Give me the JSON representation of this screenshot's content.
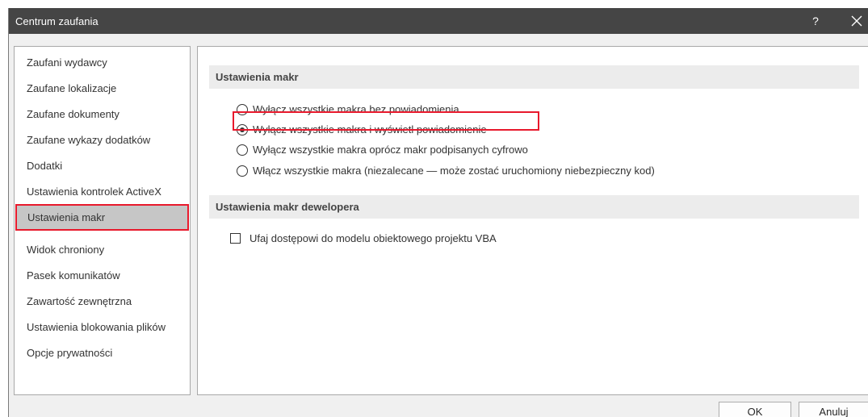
{
  "window": {
    "title": "Centrum zaufania",
    "help_label": "?"
  },
  "sidebar": {
    "items": [
      {
        "label": "Zaufani wydawcy"
      },
      {
        "label": "Zaufane lokalizacje"
      },
      {
        "label": "Zaufane dokumenty"
      },
      {
        "label": "Zaufane wykazy dodatków"
      },
      {
        "label": "Dodatki"
      },
      {
        "label": "Ustawienia kontrolek ActiveX"
      },
      {
        "label": "Ustawienia makr",
        "selected": true
      },
      {
        "label": "Widok chroniony"
      },
      {
        "label": "Pasek komunikatów"
      },
      {
        "label": "Zawartość zewnętrzna"
      },
      {
        "label": "Ustawienia blokowania plików"
      },
      {
        "label": "Opcje prywatności"
      }
    ]
  },
  "macro_settings": {
    "header": "Ustawienia makr",
    "options": [
      {
        "label": "Wyłącz wszystkie makra bez powiadomienia",
        "checked": false
      },
      {
        "label": "Wyłącz wszystkie makra i wyświetl powiadomienie",
        "checked": true
      },
      {
        "label": "Wyłącz wszystkie makra oprócz makr podpisanych cyfrowo",
        "checked": false
      },
      {
        "label": "Włącz wszystkie makra (niezalecane — może zostać uruchomiony niebezpieczny kod)",
        "checked": false
      }
    ]
  },
  "developer_settings": {
    "header": "Ustawienia makr dewelopera",
    "vba_label": "Ufaj dostępowi do modelu obiektowego projektu VBA",
    "vba_checked": false
  },
  "buttons": {
    "ok": "OK",
    "cancel": "Anuluj"
  },
  "colors": {
    "titlebar": "#454545",
    "highlight": "#e8192c",
    "selected_bg": "#c6c6c6"
  }
}
